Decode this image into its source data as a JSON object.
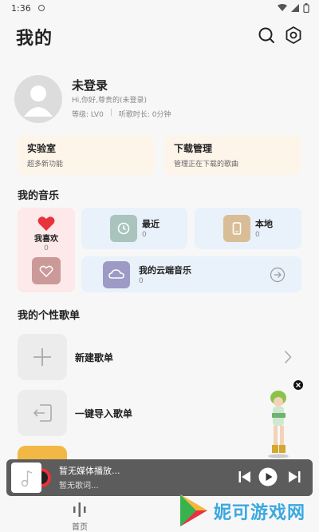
{
  "status_bar": {
    "time": "1:36"
  },
  "header": {
    "title": "我的"
  },
  "profile": {
    "name": "未登录",
    "greeting": "Hi,你好,尊贵的(未登录)",
    "level": "等级: LV0",
    "listen_time": "听歌时长: 0分钟"
  },
  "features": [
    {
      "title": "实验室",
      "subtitle": "超多新功能"
    },
    {
      "title": "下载管理",
      "subtitle": "管理正在下载的歌曲"
    }
  ],
  "my_music": {
    "section_title": "我的音乐",
    "like": {
      "label": "我喜欢",
      "count": "0"
    },
    "recent": {
      "label": "最近",
      "count": "0"
    },
    "local": {
      "label": "本地",
      "count": "0"
    },
    "cloud": {
      "label": "我的云端音乐",
      "count": "0"
    }
  },
  "playlists": {
    "section_title": "我的个性歌单",
    "new_label": "新建歌单",
    "import_label": "一键导入歌单"
  },
  "player": {
    "title": "暂无媒体播放...",
    "subtitle": "暂无歌词..."
  },
  "bottom_nav": {
    "home_label": "首页"
  },
  "watermark": {
    "text": "妮可游戏网"
  },
  "colors": {
    "feature_bg": "#fdf5ea",
    "like_bg": "#fde8ea",
    "music_card_bg": "#e9f1fb",
    "player_bg": "#5c5c5c",
    "accent_red": "#e8323c"
  }
}
